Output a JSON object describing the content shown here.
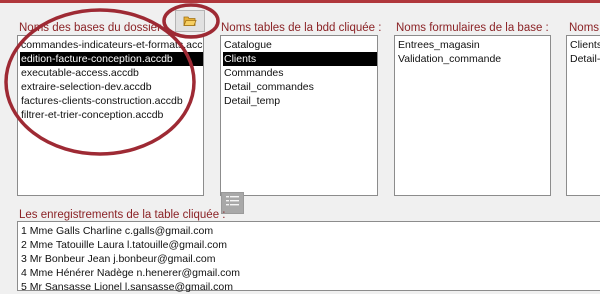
{
  "colors": {
    "label": "#8b2326",
    "accent_ring": "#9e2a34",
    "topbar": "#b0373c"
  },
  "icons": {
    "folder": "open-folder-icon",
    "filter": "filter-list-icon"
  },
  "databases": {
    "label": "Noms des bases du dossier :",
    "items": [
      "commandes-indicateurs-et-formats.accdb",
      "edition-facture-conception.accdb",
      "executable-access.accdb",
      "extraire-selection-dev.accdb",
      "factures-clients-construction.accdb",
      "filtrer-et-trier-conception.accdb"
    ],
    "selected_index": 1
  },
  "tables": {
    "label": "Noms tables de la bdd cliquée :",
    "items": [
      "Catalogue",
      "Clients",
      "Commandes",
      "Detail_commandes",
      "Detail_temp"
    ],
    "selected_index": 1
  },
  "forms": {
    "label": "Noms formulaires de la base :",
    "items": [
      "Entrees_magasin",
      "Validation_commande"
    ]
  },
  "fourth": {
    "label": "Noms r",
    "items": [
      "Clients-",
      "Detail-C"
    ]
  },
  "records": {
    "label": "Les enregistrements de la table cliquée :",
    "items": [
      "1 Mme Galls Charline c.galls@gmail.com",
      "2 Mme Tatouille Laura l.tatouille@gmail.com",
      "3 Mr Bonbeur Jean j.bonbeur@gmail.com",
      "4 Mme Hénérer Nadège n.henerer@gmail.com",
      "5 Mr Sansasse Lionel l.sansasse@gmail.com"
    ]
  }
}
